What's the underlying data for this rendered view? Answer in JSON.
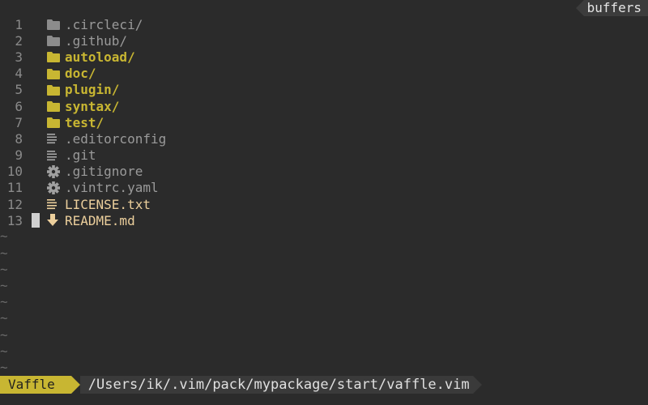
{
  "tabline": {
    "label": "buffers"
  },
  "files": [
    {
      "num": "1",
      "name": ".circleci/",
      "kind": "dir-hidden",
      "icon": "folder-icon"
    },
    {
      "num": "2",
      "name": ".github/",
      "kind": "dir-hidden",
      "icon": "folder-icon"
    },
    {
      "num": "3",
      "name": "autoload/",
      "kind": "dir",
      "icon": "folder-icon"
    },
    {
      "num": "4",
      "name": "doc/",
      "kind": "dir",
      "icon": "folder-icon"
    },
    {
      "num": "5",
      "name": "plugin/",
      "kind": "dir",
      "icon": "folder-icon"
    },
    {
      "num": "6",
      "name": "syntax/",
      "kind": "dir",
      "icon": "folder-icon"
    },
    {
      "num": "7",
      "name": "test/",
      "kind": "dir",
      "icon": "folder-icon"
    },
    {
      "num": "8",
      "name": ".editorconfig",
      "kind": "file-hidden",
      "icon": "text-file-icon"
    },
    {
      "num": "9",
      "name": ".git",
      "kind": "file-hidden",
      "icon": "text-file-icon"
    },
    {
      "num": "10",
      "name": ".gitignore",
      "kind": "file-hidden",
      "icon": "gear-icon"
    },
    {
      "num": "11",
      "name": ".vintrc.yaml",
      "kind": "file-hidden",
      "icon": "gear-icon"
    },
    {
      "num": "12",
      "name": "LICENSE.txt",
      "kind": "file",
      "icon": "text-file-icon"
    },
    {
      "num": "13",
      "name": "README.md",
      "kind": "file",
      "icon": "download-arrow-icon",
      "cursor": true
    }
  ],
  "tildes": [
    "~",
    "~",
    "~",
    "~",
    "~",
    "~",
    "~",
    "~",
    "~"
  ],
  "statusline": {
    "mode": "Vaffle",
    "path": "/Users/ik/.vim/pack/mypackage/start/vaffle.vim"
  },
  "colors": {
    "background": "#2b2b2b",
    "directory": "#c8b632",
    "hidden": "#9a9a9a",
    "file": "#eccf9c",
    "mode_bg": "#c8b632"
  }
}
